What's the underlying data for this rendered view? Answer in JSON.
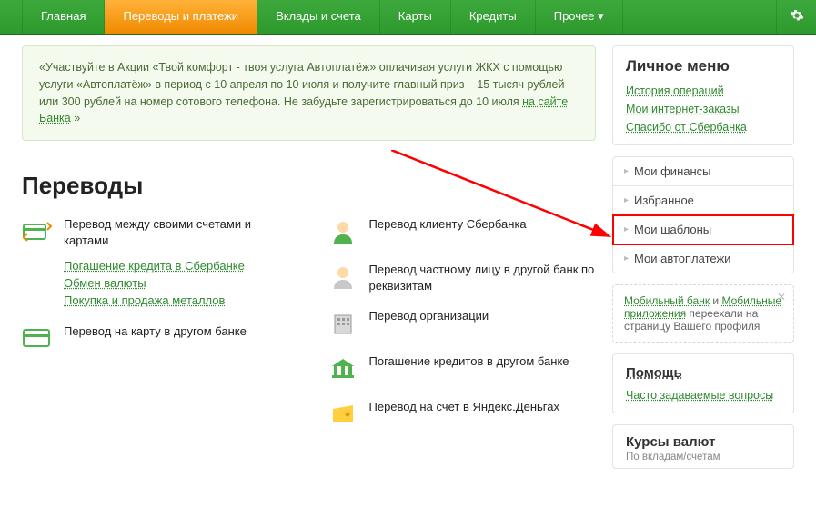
{
  "nav": {
    "items": [
      {
        "label": "Главная"
      },
      {
        "label": "Переводы и платежи",
        "active": true
      },
      {
        "label": "Вклады и счета"
      },
      {
        "label": "Карты"
      },
      {
        "label": "Кредиты"
      },
      {
        "label": "Прочее ▾"
      }
    ]
  },
  "promo": {
    "text_pre": "«Участвуйте в Акции «Твой комфорт - твоя услуга Автоплатёж» оплачивая услуги ЖКХ с помощью услуги «Автоплатёж» в период с 10 апреля по 10 июля и получите главный приз – 15 тысяч рублей или 300 рублей на номер сотового телефона. Не забудьте зарегистрироваться до 10 июля ",
    "link": "на сайте Банка",
    "text_post": " »"
  },
  "section_title": "Переводы",
  "left_items": [
    {
      "title": "Перевод между своими счетами и картами"
    },
    {
      "title": "Перевод на карту в другом банке"
    }
  ],
  "left_sublinks": [
    "Погашение кредита в Сбербанке",
    "Обмен валюты",
    "Покупка и продажа металлов"
  ],
  "right_items": [
    {
      "title": "Перевод клиенту Сбербанка"
    },
    {
      "title": "Перевод частному лицу в другой банк по реквизитам"
    },
    {
      "title": "Перевод организации"
    },
    {
      "title": "Погашение кредитов в другом банке"
    },
    {
      "title": "Перевод на счет в Яндекс.Деньгах"
    }
  ],
  "side": {
    "menu_title": "Личное меню",
    "menu_links": [
      "История операций",
      "Мои интернет-заказы",
      "Спасибо от Сбербанка"
    ],
    "exp_rows": [
      "Мои финансы",
      "Избранное",
      "Мои шаблоны",
      "Мои автоплатежи"
    ],
    "note": {
      "link1": "Мобильный банк",
      "mid": " и ",
      "link2": "Мобильные приложения",
      "tail": " переехали на страницу Вашего профиля"
    },
    "help_title": "Помощь",
    "help_link": "Часто задаваемые вопросы",
    "rates_title": "Курсы валют",
    "rates_sub": "По вкладам/счетам"
  }
}
